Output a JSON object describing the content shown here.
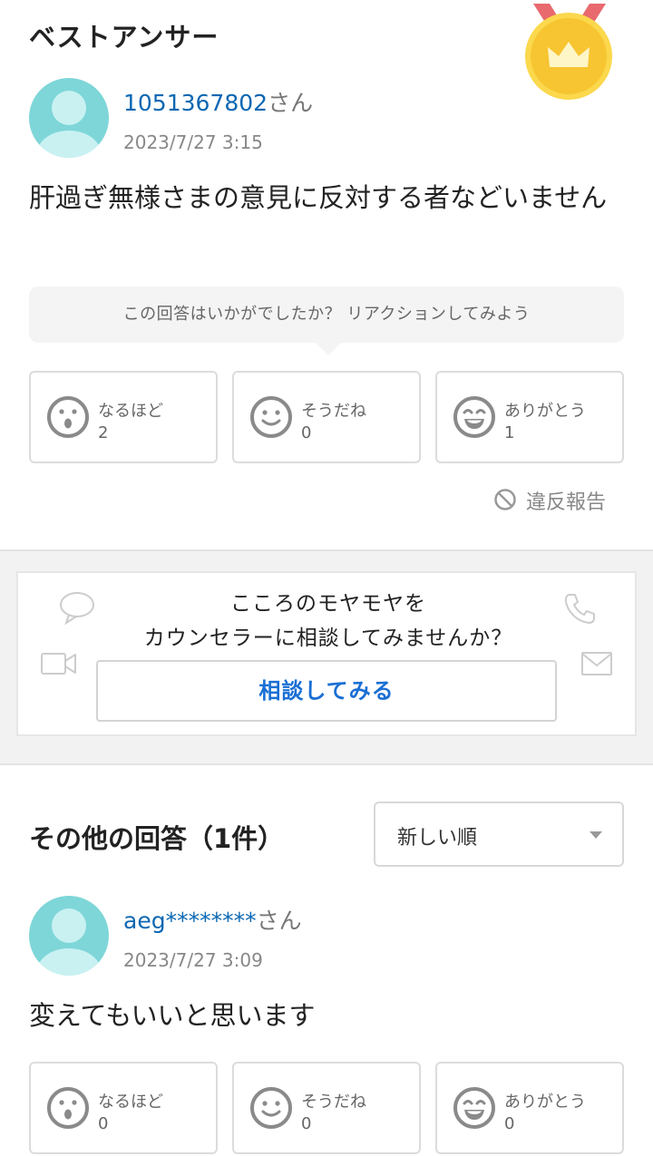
{
  "best_answer": {
    "section_title": "ベストアンサー",
    "user_name": "1051367802",
    "user_suffix": "さん",
    "date": "2023/7/27 3:15",
    "text": "肝過ぎ無様さまの意見に反対する者などいません",
    "reaction_prompt": "この回答はいかがでしたか？ リアクションしてみよう",
    "reactions": [
      {
        "label": "なるほど",
        "count": "2",
        "icon": "surprised-face-icon"
      },
      {
        "label": "そうだね",
        "count": "0",
        "icon": "smile-face-icon"
      },
      {
        "label": "ありがとう",
        "count": "1",
        "icon": "grin-face-icon"
      }
    ],
    "report_label": "違反報告"
  },
  "counsel": {
    "line1": "こころのモヤモヤを",
    "line2": "カウンセラーに相談してみませんか？",
    "button_label": "相談してみる",
    "icons": [
      "chat-bubble-icon",
      "phone-icon",
      "video-icon",
      "mail-icon"
    ]
  },
  "other_answers": {
    "title": "その他の回答（1件）",
    "sort_selected": "新しい順",
    "answers": [
      {
        "user_name": "aeg********",
        "user_suffix": "さん",
        "date": "2023/7/27 3:09",
        "text": "変えてもいいと思います",
        "reactions": [
          {
            "label": "なるほど",
            "count": "0",
            "icon": "surprised-face-icon"
          },
          {
            "label": "そうだね",
            "count": "0",
            "icon": "smile-face-icon"
          },
          {
            "label": "ありがとう",
            "count": "0",
            "icon": "grin-face-icon"
          }
        ]
      }
    ]
  },
  "colors": {
    "link_blue": "#0b67b2",
    "button_blue": "#1a6fd4",
    "medal_gold": "#f7c531",
    "avatar_teal": "#7ed6d8"
  }
}
